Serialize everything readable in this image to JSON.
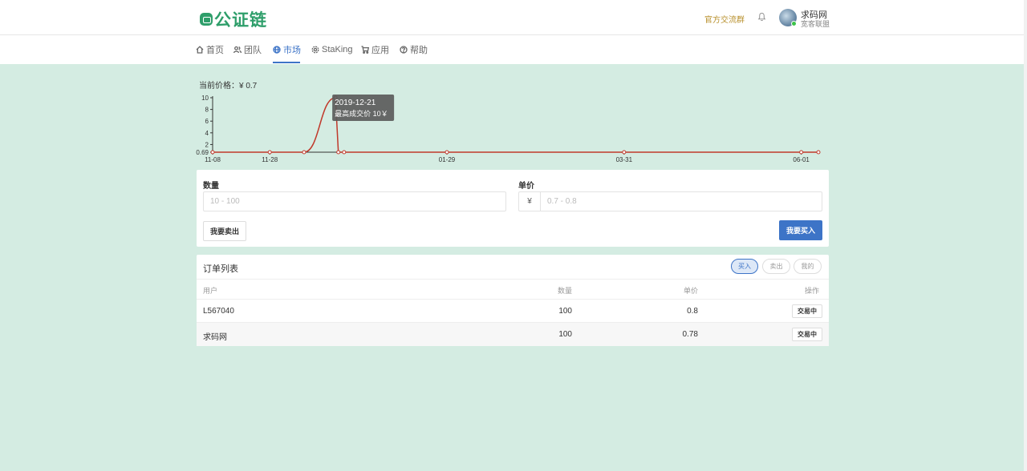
{
  "header": {
    "logo_text": "公证链",
    "group_link": "官方交流群",
    "user_name": "求码网",
    "user_sub": "宽客联盟"
  },
  "nav": {
    "items": [
      {
        "label": "首页",
        "icon": "home-icon"
      },
      {
        "label": "团队",
        "icon": "users-icon"
      },
      {
        "label": "市场",
        "icon": "globe-icon"
      },
      {
        "label": "StaKing",
        "icon": "settings-icon"
      },
      {
        "label": "应用",
        "icon": "cart-icon"
      },
      {
        "label": "帮助",
        "icon": "help-icon"
      }
    ],
    "active": "市场"
  },
  "price": {
    "label": "当前价格：",
    "value": "¥ 0.7"
  },
  "chart_data": {
    "type": "line",
    "x": [
      "2019-11-08",
      "2019-11-28",
      "2019-12-10",
      "2019-12-21",
      "2019-12-22",
      "2019-12-24",
      "2020-01-29",
      "2020-03-31",
      "2020-06-01",
      "2020-06-07"
    ],
    "series": [
      {
        "values": [
          0.69,
          0.69,
          0.69,
          10,
          0.69,
          0.69,
          0.69,
          0.69,
          0.69,
          0.69
        ],
        "color": "#c0392b"
      }
    ],
    "y_ticks": [
      "0.69",
      "2",
      "4",
      "6",
      "8",
      "10"
    ],
    "x_ticks": [
      "11-08",
      "11-28",
      "01-29",
      "03-31",
      "06-01"
    ],
    "ylim": [
      0.69,
      10
    ],
    "tooltip": {
      "date": "2019-12-21",
      "text": "最高成交价 10￥"
    }
  },
  "form": {
    "qty_label": "数量",
    "qty_placeholder": "10 - 100",
    "price_label": "单价",
    "price_prefix": "¥",
    "price_placeholder": "0.7 - 0.8",
    "sell_label": "我要卖出",
    "buy_label": "我要买入"
  },
  "orders": {
    "title": "订单列表",
    "filters": [
      "买入",
      "卖出",
      "我的"
    ],
    "active_filter": "买入",
    "columns": [
      "用户",
      "数量",
      "单价",
      "操作"
    ],
    "rows": [
      {
        "user": "L567040",
        "qty": "100",
        "price": "0.8",
        "action": "交易中"
      },
      {
        "user": "求码网",
        "qty": "100",
        "price": "0.78",
        "action": "交易中"
      }
    ]
  },
  "colors": {
    "accent": "#3d74c7",
    "brand": "#2e9e6a",
    "background": "#d4ece2",
    "line": "#c0392b"
  }
}
